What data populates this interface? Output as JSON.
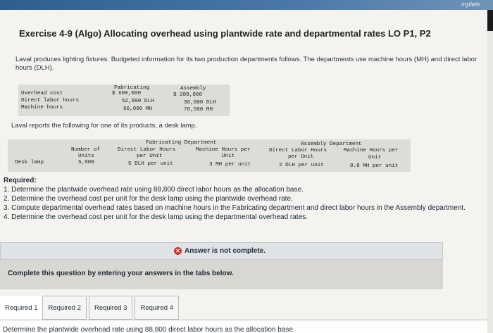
{
  "topbar": {
    "right_text": "mplete"
  },
  "title": "Exercise 4-9 (Algo) Allocating overhead using plantwide rate and departmental rates LO P1, P2",
  "intro": "Laval produces lighting fixtures. Budgeted information for its two production departments follows. The departments use machine hours (MH) and direct labor hours (DLH).",
  "budget_table": {
    "headers": [
      "Fabricating",
      "Assembly"
    ],
    "rows": [
      {
        "label": "Overhead cost",
        "fab": "$ 600,000",
        "asm": "$ 288,000"
      },
      {
        "label": "Direct labor hours",
        "fab": "52,800 DLH",
        "asm": "36,000 DLH"
      },
      {
        "label": "Machine hours",
        "fab": "60,000 MH",
        "asm": "76,500 MH"
      }
    ]
  },
  "reports_text": "Laval reports the following for one of its products, a desk lamp.",
  "product_table": {
    "group_fab": "Fabricating Department",
    "group_asm": "Assembly Department",
    "col_units": [
      "Number of",
      "Units"
    ],
    "col_fab_dlh": [
      "Direct Labor Hours",
      "per Unit"
    ],
    "col_fab_mh": [
      "Machine Hours per",
      "Unit"
    ],
    "col_asm_dlh": [
      "Direct Labor Hours",
      "per Unit"
    ],
    "col_asm_mh": [
      "Machine Hours per",
      "Unit"
    ],
    "row": {
      "label": "Desk lamp",
      "units": "5,000",
      "fab_dlh": "5 DLH per unit",
      "fab_mh": "3 MH per unit",
      "asm_dlh": "2 DLH per unit",
      "asm_mh": "0.8 MH per unit"
    }
  },
  "required": {
    "heading": "Required:",
    "items": [
      "1. Determine the plantwide overhead rate using 88,800 direct labor hours as the allocation base.",
      "2. Determine the overhead cost per unit for the desk lamp using the plantwide overhead rate.",
      "3. Compute departmental overhead rates based on machine hours in the Fabricating department and direct labor hours in the Assembly department.",
      "4. Determine the overhead cost per unit for the desk lamp using the departmental overhead rates."
    ]
  },
  "status": {
    "answer_text": "Answer is not complete.",
    "icon": "x-circle-icon",
    "icon_color": "#d0312d"
  },
  "complete_text": "Complete this question by entering your answers in the tabs below.",
  "tabs": [
    "Required 1",
    "Required 2",
    "Required 3",
    "Required 4"
  ],
  "bottom_text": "Determine the plantwide overhead rate using 88,800 direct labor hours as the allocation base."
}
